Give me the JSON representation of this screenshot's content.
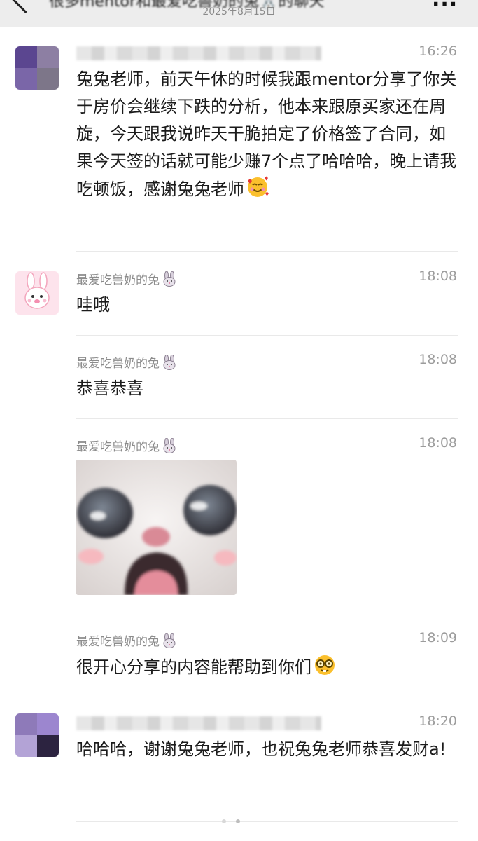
{
  "header": {
    "title": "很多mentor和最爱吃兽奶的兔🐰的聊天",
    "date": "2025年8月15日"
  },
  "messages": [
    {
      "sender": "",
      "time": "16:26",
      "text": "兔兔老师，前天午休的时候我跟mentor分享了你关于房价会继续下跌的分析，他本来跟原买家还在周旋，今天跟我说昨天干脆拍定了价格签了合同，如果今天签的话就可能少赚7个点了哈哈哈，晚上请我吃顿饭，感谢兔兔老师",
      "emoji": "smiling-face-with-hearts-emoji"
    },
    {
      "sender": "最爱吃兽奶的兔",
      "time": "18:08",
      "text": "哇哦"
    },
    {
      "sender": "最爱吃兽奶的兔",
      "time": "18:08",
      "text": "恭喜恭喜"
    },
    {
      "sender": "最爱吃兽奶的兔",
      "time": "18:08",
      "sticker": "surprised-bunny-sticker"
    },
    {
      "sender": "最爱吃兽奶的兔",
      "time": "18:09",
      "text": "很开心分享的内容能帮助到你们",
      "emoji": "nerd-face-emoji"
    },
    {
      "sender": "",
      "time": "18:20",
      "text": "哈哈哈，谢谢兔兔老师，也祝兔兔老师恭喜发财a!"
    }
  ],
  "colors": {
    "header_bg": "#ededed",
    "text": "#1b1b1b",
    "meta": "#8c8c8c"
  }
}
